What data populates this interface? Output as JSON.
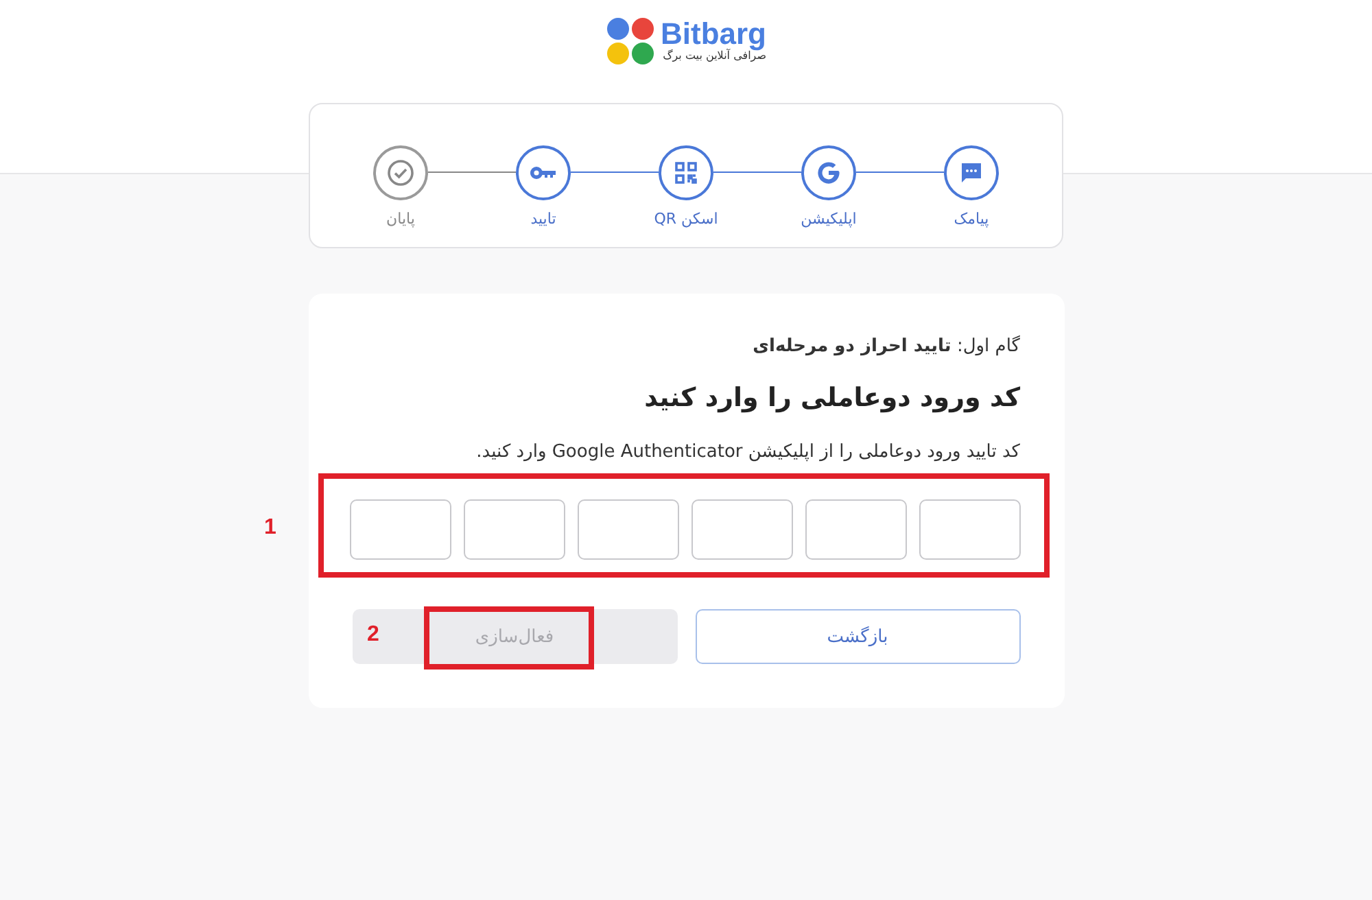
{
  "logo": {
    "name": "Bitbarg",
    "tagline": "صرافی آنلاین بیت برگ"
  },
  "steps": [
    {
      "label": "پیامک",
      "active": true
    },
    {
      "label": "اپلیکیشن",
      "active": true
    },
    {
      "label": "اسکن QR",
      "active": true
    },
    {
      "label": "تایید",
      "active": true
    },
    {
      "label": "پایان",
      "active": false
    }
  ],
  "form": {
    "step_heading": "گام اول: **تایید احراز دو مرحله‌ای**",
    "title": "کد ورود دوعاملی را وارد کنید",
    "description": "کد تایید ورود دوعاملی را از اپلیکیشن Google Authenticator وارد کنید.",
    "code_fields": [
      {
        "filled": false
      },
      {
        "filled": false
      },
      {
        "filled": false
      },
      {
        "filled": false
      },
      {
        "filled": false
      },
      {
        "filled": false
      }
    ],
    "code_annotation": "1",
    "buttons": [
      {
        "label": "بازگشت",
        "kind": "outline",
        "disabled": false
      },
      {
        "label": "فعال‌سازی",
        "kind": "primary",
        "disabled": true,
        "annotation": "2"
      }
    ]
  }
}
